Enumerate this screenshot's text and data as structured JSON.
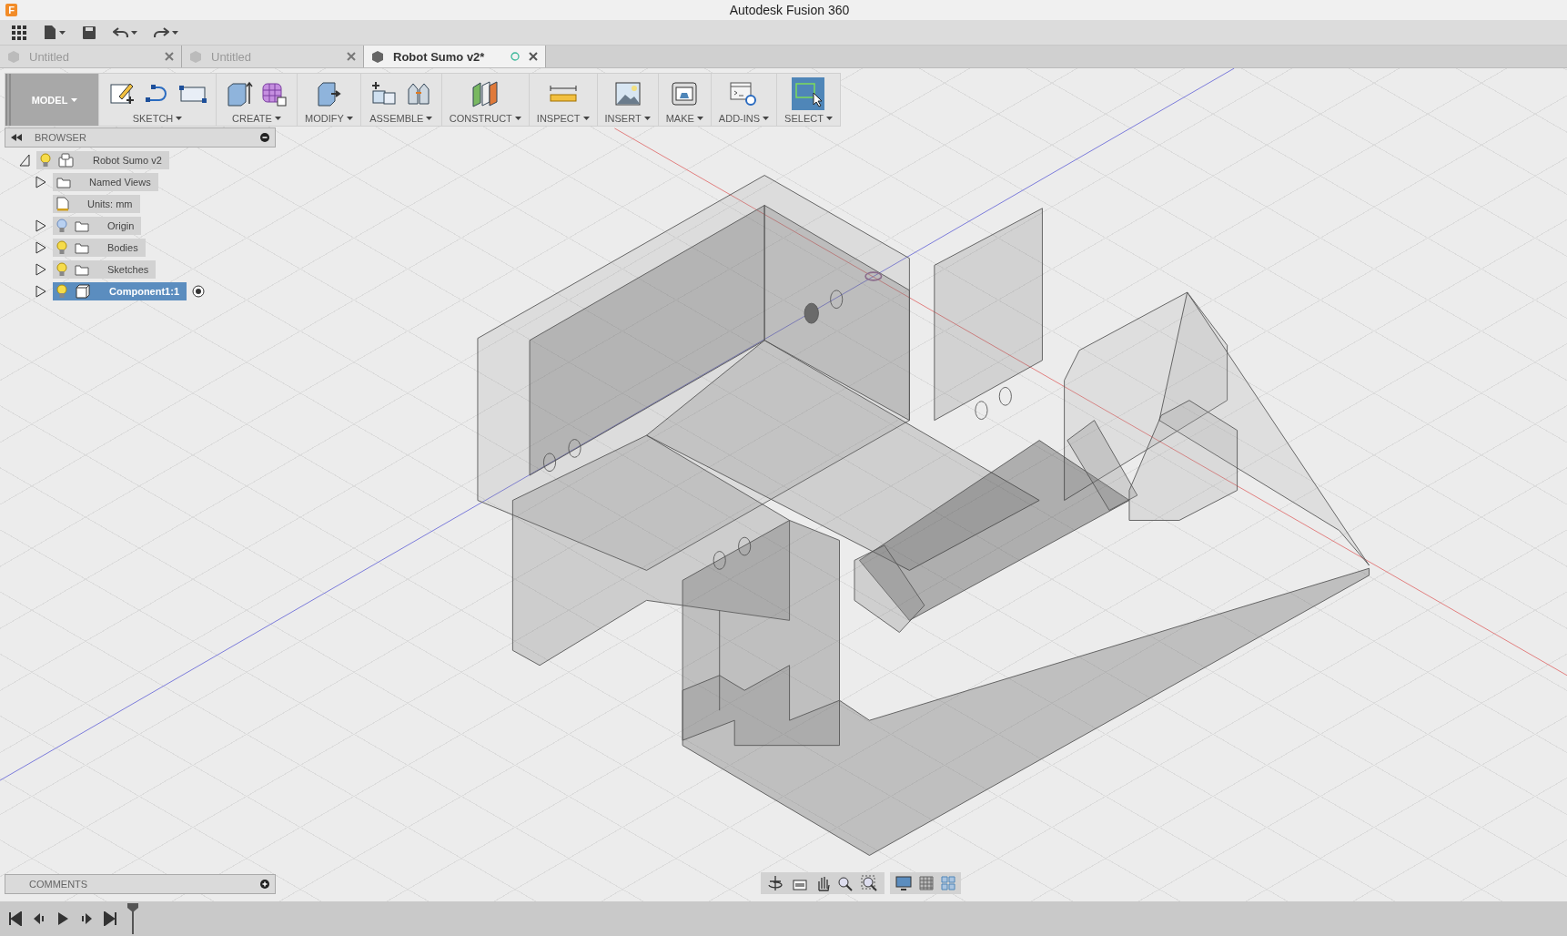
{
  "window": {
    "logo": "F",
    "title": "Autodesk Fusion 360"
  },
  "tabs": [
    {
      "label": "Untitled",
      "selected": false
    },
    {
      "label": "Untitled",
      "selected": false
    },
    {
      "label": "Robot Sumo v2*",
      "selected": true,
      "unsaved": true
    }
  ],
  "toolbar": {
    "workspace": "MODEL",
    "groups": [
      {
        "kind": "sketch",
        "label": "SKETCH",
        "selected": false
      },
      {
        "kind": "create",
        "label": "CREATE",
        "selected": false
      },
      {
        "kind": "modify",
        "label": "MODIFY",
        "selected": false
      },
      {
        "kind": "assemble",
        "label": "ASSEMBLE",
        "selected": false
      },
      {
        "kind": "construct",
        "label": "CONSTRUCT",
        "selected": false
      },
      {
        "kind": "inspect",
        "label": "INSPECT",
        "selected": false
      },
      {
        "kind": "insert",
        "label": "INSERT",
        "selected": false
      },
      {
        "kind": "make",
        "label": "MAKE",
        "selected": false
      },
      {
        "kind": "addins",
        "label": "ADD-INS",
        "selected": false
      },
      {
        "kind": "select",
        "label": "SELECT",
        "selected": true
      }
    ]
  },
  "browser": {
    "title": "BROWSER",
    "tree": {
      "label": "Robot Sumo v2",
      "kind": "root",
      "visible": true,
      "expanded": true,
      "selected": false,
      "children": [
        {
          "label": "Named Views",
          "kind": "folder",
          "expanded": false,
          "selected": false
        },
        {
          "label": "Units: mm",
          "kind": "units",
          "selected": false
        },
        {
          "label": "Origin",
          "kind": "folder",
          "visible": false,
          "expanded": false,
          "selected": false
        },
        {
          "label": "Bodies",
          "kind": "folder",
          "visible": true,
          "expanded": false,
          "selected": false
        },
        {
          "label": "Sketches",
          "kind": "folder",
          "visible": true,
          "expanded": false,
          "selected": false
        },
        {
          "label": "Component1:1",
          "kind": "component",
          "visible": true,
          "expanded": false,
          "selected": true,
          "active": true
        }
      ]
    }
  },
  "comments": {
    "title": "COMMENTS"
  }
}
